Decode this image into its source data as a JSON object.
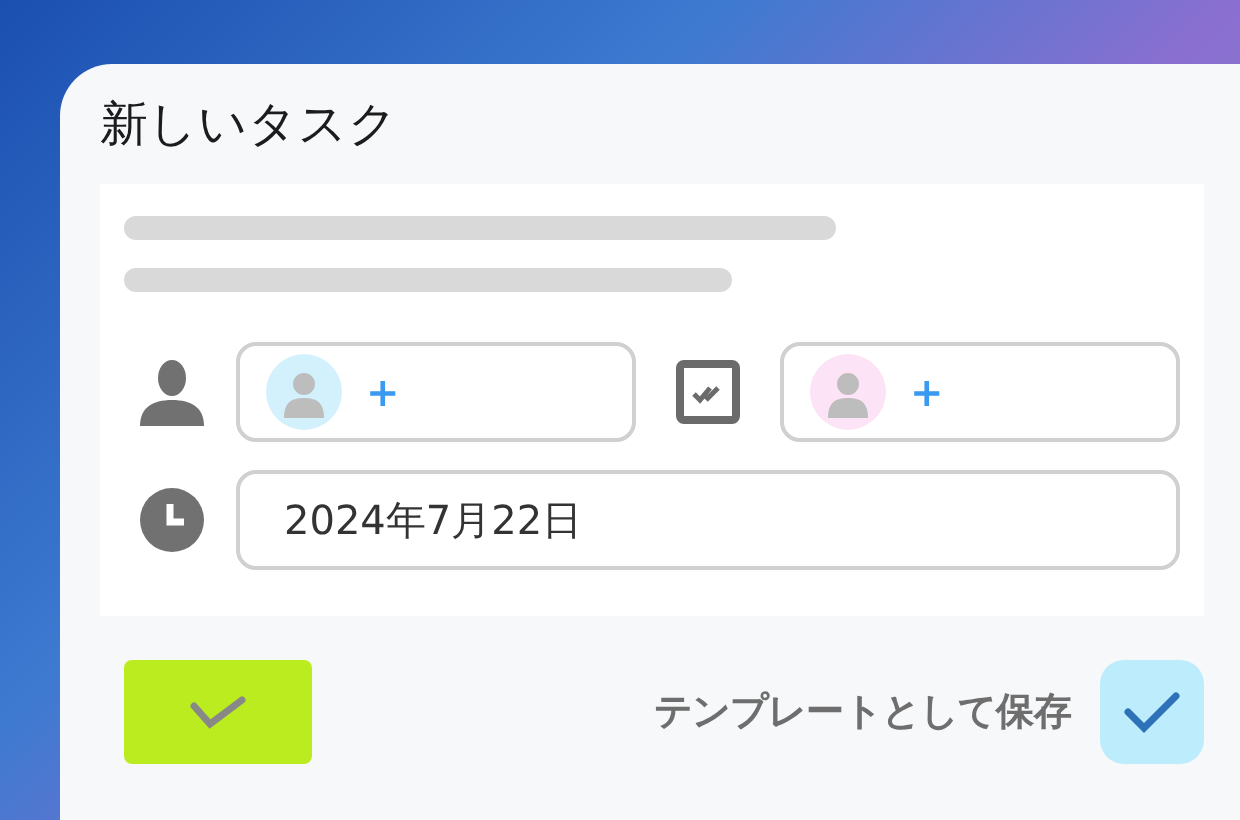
{
  "dialog": {
    "title": "新しいタスク"
  },
  "people": [
    {
      "add": "+",
      "color": "#d3f1fc"
    },
    {
      "add": "+",
      "color": "#fce4f6"
    }
  ],
  "due_date": {
    "value": "2024年7月22日"
  },
  "confirm": {
    "enabled": true
  },
  "template": {
    "label": "テンプレートとして保存",
    "checked": true
  }
}
